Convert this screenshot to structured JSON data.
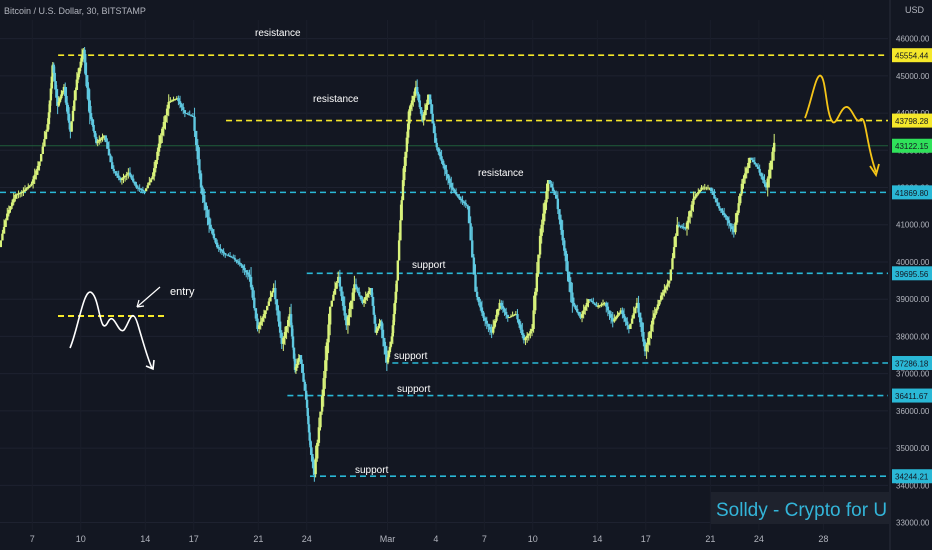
{
  "header": {
    "symbol": "Bitcoin / U.S. Dollar, 30, BITSTAMP"
  },
  "currency_label": "USD",
  "watermark": "Solldy - Crypto for U",
  "colors": {
    "background": "#131722",
    "resistance": "#f5e82a",
    "support": "#2ab8d6",
    "price_label_current": "#2fe25a",
    "candle_up": "#d8f27b",
    "candle_down": "#5fc8e0",
    "watermark_bg": "#1e222d",
    "watermark_text": "#33b5d9",
    "sketch": "#ffffff",
    "projection": "#f5c518"
  },
  "chart_data": {
    "type": "line",
    "title": "Bitcoin / U.S. Dollar, 30, BITSTAMP",
    "ylabel": "USD",
    "ylim": [
      32800,
      46500
    ],
    "y_ticks": [
      33000,
      34000,
      35000,
      36000,
      37000,
      38000,
      39000,
      40000,
      41000,
      42000,
      43000,
      44000,
      45000,
      46000
    ],
    "y_tick_labels": [
      "33000.00",
      "34000.00",
      "35000.00",
      "36000.00",
      "37000.00",
      "38000.00",
      "39000.00",
      "40000.00",
      "41000.00",
      "42000.00",
      "43000.00",
      "44000.00",
      "45000.00",
      "46000.00"
    ],
    "x_tick_labels": [
      "7",
      "10",
      "14",
      "17",
      "21",
      "24",
      "Mar",
      "4",
      "7",
      "10",
      "14",
      "17",
      "21",
      "24",
      "28"
    ],
    "x_ticks_day": [
      7,
      10,
      14,
      17,
      21,
      24,
      29,
      32,
      35,
      38,
      42,
      45,
      49,
      52,
      56
    ],
    "xlim_day": [
      5,
      60
    ],
    "price_path": {
      "day": [
        5,
        5.5,
        6,
        6.5,
        7,
        7.5,
        8,
        8.3,
        8.6,
        9,
        9.4,
        9.8,
        10.2,
        10.6,
        11,
        11.5,
        12,
        12.5,
        13,
        13.5,
        14,
        14.5,
        15,
        15.5,
        16,
        16.5,
        17,
        17.5,
        18,
        18.5,
        19,
        19.5,
        20,
        20.5,
        21,
        21.5,
        22,
        22.5,
        23,
        23.3,
        23.6,
        24,
        24.2,
        24.5,
        25,
        25.5,
        26,
        26.5,
        27,
        27.5,
        28,
        28.3,
        28.6,
        29,
        29.3,
        29.6,
        30,
        30.4,
        30.8,
        31.2,
        31.6,
        32,
        32.5,
        33,
        33.5,
        34,
        34.5,
        35,
        35.5,
        36,
        36.5,
        37,
        37.5,
        38,
        38.5,
        39,
        39.5,
        40,
        40.5,
        41,
        41.5,
        42,
        42.5,
        43,
        43.5,
        44,
        44.5,
        45,
        45.5,
        46,
        46.5,
        47,
        47.5,
        48,
        48.5,
        49,
        49.5,
        50,
        50.5,
        51,
        51.5,
        52,
        52.5,
        53
      ],
      "price": [
        40400,
        41300,
        41800,
        41900,
        42100,
        42700,
        43700,
        45300,
        44200,
        44700,
        43500,
        44900,
        45700,
        44000,
        43200,
        43400,
        42500,
        42200,
        42400,
        42000,
        41900,
        42300,
        43400,
        44300,
        44400,
        44000,
        43900,
        42000,
        41000,
        40400,
        40200,
        40100,
        39900,
        39600,
        38200,
        38700,
        39300,
        37800,
        38600,
        37100,
        37500,
        36300,
        35200,
        34300,
        36400,
        38800,
        39600,
        38300,
        39400,
        38900,
        39300,
        38100,
        38400,
        37300,
        38000,
        39500,
        42200,
        44100,
        44700,
        43800,
        44500,
        43200,
        42600,
        42000,
        41700,
        41500,
        39200,
        38500,
        38100,
        38900,
        38500,
        38600,
        37900,
        38200,
        40700,
        42200,
        41700,
        40300,
        38900,
        38500,
        39000,
        38800,
        38900,
        38400,
        38700,
        38200,
        38900,
        37600,
        38500,
        39100,
        39500,
        41000,
        40900,
        41700,
        42000,
        42000,
        41500,
        41200,
        40800,
        42100,
        42800,
        42500,
        42000,
        43200
      ]
    },
    "horizontal_levels": [
      {
        "price": 45554.44,
        "label": "45554.44",
        "kind": "resistance",
        "text": "resistance",
        "start_day": 8.6
      },
      {
        "price": 43798.28,
        "label": "43798.28",
        "kind": "resistance",
        "text": "resistance",
        "start_day": 19.0
      },
      {
        "price": 41869.8,
        "label": "41869.80",
        "kind": "resistance",
        "text": "resistance",
        "start_day": 5.0
      },
      {
        "price": 39695.56,
        "label": "39695.56",
        "kind": "support",
        "text": "support",
        "start_day": 24.0
      },
      {
        "price": 37286.18,
        "label": "37286.18",
        "kind": "support",
        "text": "support",
        "start_day": 29.3
      },
      {
        "price": 36411.67,
        "label": "36411.67",
        "kind": "support",
        "text": "support",
        "start_day": 22.8
      },
      {
        "price": 34244.21,
        "label": "34244.21",
        "kind": "support",
        "text": "support",
        "start_day": 24.2
      }
    ],
    "current_price": {
      "price": 43122.15,
      "label": "43122.15"
    },
    "annotation_entry": "entry"
  }
}
